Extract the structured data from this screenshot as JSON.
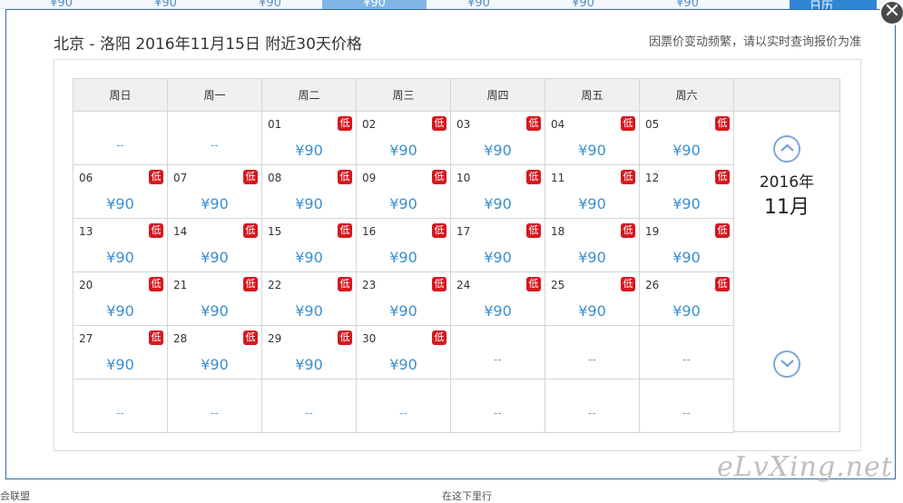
{
  "top_strip": {
    "prices": [
      "¥90",
      "¥90",
      "¥90",
      "¥90",
      "¥90",
      "¥90",
      "¥90"
    ],
    "selected_index": 3,
    "calendar_label": "日历"
  },
  "bottom_fragments": {
    "left": "会联盟",
    "mid": "在这下里行"
  },
  "modal": {
    "title": "北京 - 洛阳 2016年11月15日 附近30天价格",
    "note": "因票价变动频繁，请以实时查询报价为准",
    "close_symbol": "✕"
  },
  "weekdays": [
    "周日",
    "周一",
    "周二",
    "周三",
    "周四",
    "周五",
    "周六"
  ],
  "low_badge": "低",
  "empty_marker": "--",
  "nav": {
    "year": "2016年",
    "month": "11月"
  },
  "weeks": [
    [
      {
        "e": true
      },
      {
        "e": true
      },
      {
        "d": "01",
        "p": "¥90"
      },
      {
        "d": "02",
        "p": "¥90"
      },
      {
        "d": "03",
        "p": "¥90"
      },
      {
        "d": "04",
        "p": "¥90"
      },
      {
        "d": "05",
        "p": "¥90"
      }
    ],
    [
      {
        "d": "06",
        "p": "¥90"
      },
      {
        "d": "07",
        "p": "¥90"
      },
      {
        "d": "08",
        "p": "¥90"
      },
      {
        "d": "09",
        "p": "¥90"
      },
      {
        "d": "10",
        "p": "¥90"
      },
      {
        "d": "11",
        "p": "¥90"
      },
      {
        "d": "12",
        "p": "¥90"
      }
    ],
    [
      {
        "d": "13",
        "p": "¥90"
      },
      {
        "d": "14",
        "p": "¥90"
      },
      {
        "d": "15",
        "p": "¥90"
      },
      {
        "d": "16",
        "p": "¥90"
      },
      {
        "d": "17",
        "p": "¥90"
      },
      {
        "d": "18",
        "p": "¥90"
      },
      {
        "d": "19",
        "p": "¥90"
      }
    ],
    [
      {
        "d": "20",
        "p": "¥90"
      },
      {
        "d": "21",
        "p": "¥90"
      },
      {
        "d": "22",
        "p": "¥90"
      },
      {
        "d": "23",
        "p": "¥90"
      },
      {
        "d": "24",
        "p": "¥90"
      },
      {
        "d": "25",
        "p": "¥90"
      },
      {
        "d": "26",
        "p": "¥90"
      }
    ],
    [
      {
        "d": "27",
        "p": "¥90"
      },
      {
        "d": "28",
        "p": "¥90"
      },
      {
        "d": "29",
        "p": "¥90"
      },
      {
        "d": "30",
        "p": "¥90"
      },
      {
        "e": true
      },
      {
        "e": true
      },
      {
        "e": true
      }
    ],
    [
      {
        "e": true
      },
      {
        "e": true
      },
      {
        "e": true
      },
      {
        "e": true
      },
      {
        "e": true
      },
      {
        "e": true
      },
      {
        "e": true
      }
    ]
  ],
  "watermark": "eLvXing.net"
}
